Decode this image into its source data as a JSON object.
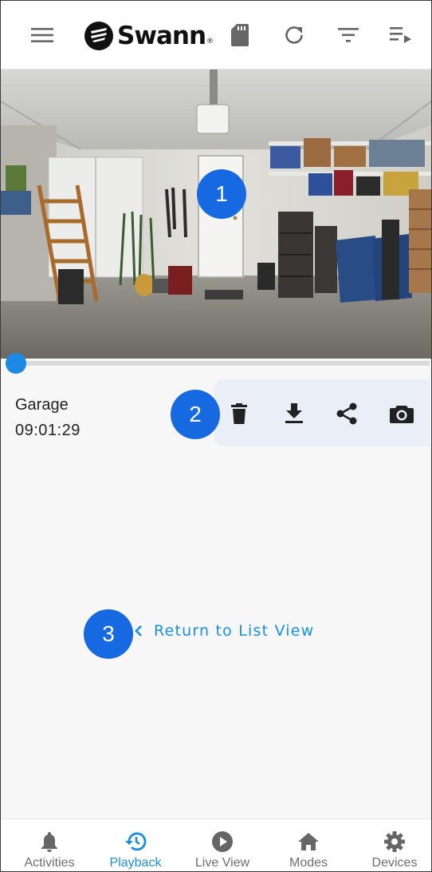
{
  "header": {
    "logo_text": "Swann",
    "logo_mark": "®",
    "icons": [
      "menu-icon",
      "sd-card-icon",
      "refresh-icon",
      "filter-icon",
      "playlist-icon"
    ]
  },
  "player": {
    "progress": 0.0
  },
  "clip": {
    "camera_name": "Garage",
    "timestamp": "09:01:29"
  },
  "actions": [
    "delete-icon",
    "download-icon",
    "share-icon",
    "camera-snapshot-icon"
  ],
  "badges": {
    "one": "1",
    "two": "2",
    "three": "3"
  },
  "return_link": {
    "label": "Return to List View"
  },
  "nav": {
    "items": [
      {
        "label": "Activities",
        "icon": "bell-icon"
      },
      {
        "label": "Playback",
        "icon": "history-icon",
        "active": true
      },
      {
        "label": "Live View",
        "icon": "play-icon"
      },
      {
        "label": "Modes",
        "icon": "home-icon"
      },
      {
        "label": "Devices",
        "icon": "gear-icon"
      }
    ]
  },
  "colors": {
    "accent": "#1a8fe0",
    "badge": "#1669e0",
    "action_bar": "#e9eef7"
  }
}
